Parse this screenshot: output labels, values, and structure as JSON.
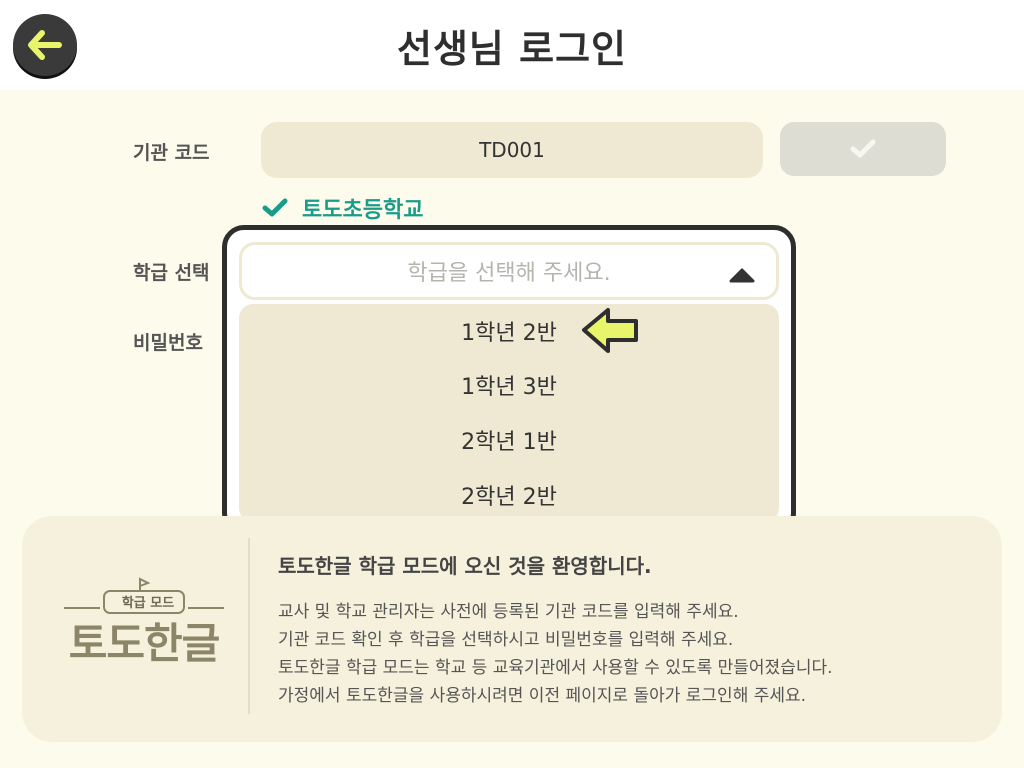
{
  "header": {
    "title": "선생님 로그인",
    "back_icon": "arrow-left-icon"
  },
  "form": {
    "org_code_label": "기관 코드",
    "org_code_value": "TD001",
    "confirm_icon": "check-icon",
    "verified_school": "토도초등학교",
    "class_label": "학급 선택",
    "password_label": "비밀번호"
  },
  "dropdown": {
    "placeholder": "학급을 선택해 주세요.",
    "caret_icon": "caret-up-icon",
    "options": [
      "1학년 2반",
      "1학년 3반",
      "2학년 1반",
      "2학년 2반"
    ],
    "pointer_icon": "arrow-pointer-icon"
  },
  "info": {
    "logo_sub": "학급 모드",
    "logo_main": "토도한글",
    "welcome": "토도한글 학급 모드에 오신 것을 환영합니다.",
    "lines": [
      "교사 및 학교 관리자는 사전에 등록된 기관 코드를 입력해 주세요.",
      "기관 코드 확인 후 학급을 선택하시고 비밀번호를 입력해 주세요.",
      "토도한글 학급 모드는 학교 등 교육기관에서 사용할 수 있도록 만들어졌습니다.",
      "가정에서 토도한글을 사용하시려면 이전 페이지로 돌아가 로그인해 주세요."
    ]
  },
  "colors": {
    "background": "#fdfbec",
    "accent_green": "#1a9c8a",
    "arrow_yellow": "#e8f56a",
    "field_beige": "#efe9d3"
  }
}
